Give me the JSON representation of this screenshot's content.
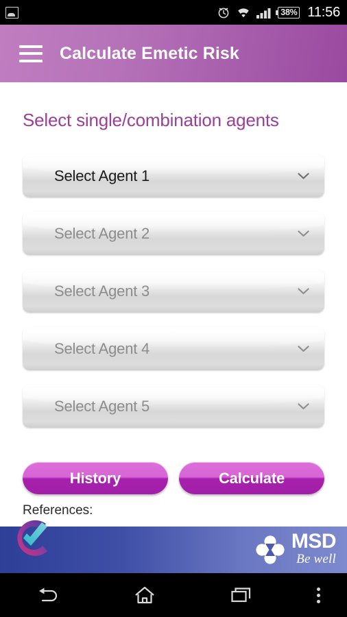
{
  "status_bar": {
    "gallery_icon": "gallery-icon",
    "alarm_icon": "alarm-clock-icon",
    "wifi_icon": "wifi-icon",
    "signal_icon": "signal-bars-icon",
    "battery_icon": "battery-icon",
    "battery_percent": "38%",
    "time": "11:56"
  },
  "app_bar": {
    "menu_icon": "hamburger-menu-icon",
    "title": "Calculate Emetic Risk",
    "gradient_start": "#c07ec0",
    "gradient_end": "#9a4aa0"
  },
  "content": {
    "heading": "Select single/combination agents",
    "heading_color": "#9b3f96",
    "dropdowns": [
      {
        "label": "Select Agent 1",
        "state": "enabled",
        "chevron": "chevron-down-icon"
      },
      {
        "label": "Select Agent 2",
        "state": "disabled",
        "chevron": "chevron-down-icon"
      },
      {
        "label": "Select Agent 3",
        "state": "disabled",
        "chevron": "chevron-down-icon"
      },
      {
        "label": "Select Agent 4",
        "state": "disabled",
        "chevron": "chevron-down-icon"
      },
      {
        "label": "Select Agent 5",
        "state": "disabled",
        "chevron": "chevron-down-icon"
      }
    ],
    "buttons": {
      "history_label": "History",
      "calculate_label": "Calculate",
      "accent_top": "#dd6ed9",
      "accent_bottom": "#a21fa8"
    },
    "references_label": "References:"
  },
  "banner": {
    "brand": "MSD",
    "tagline": "Be well",
    "logo_icon": "msd-clover-logo-icon",
    "app_logo_icon": "checkmark-circle-logo-icon",
    "gradient_start": "#2e3f98",
    "gradient_end": "#7e8ace"
  },
  "nav_bar": {
    "back_icon": "back-arrow-icon",
    "home_icon": "home-icon",
    "recents_icon": "recent-apps-icon",
    "overflow_icon": "overflow-menu-icon"
  }
}
